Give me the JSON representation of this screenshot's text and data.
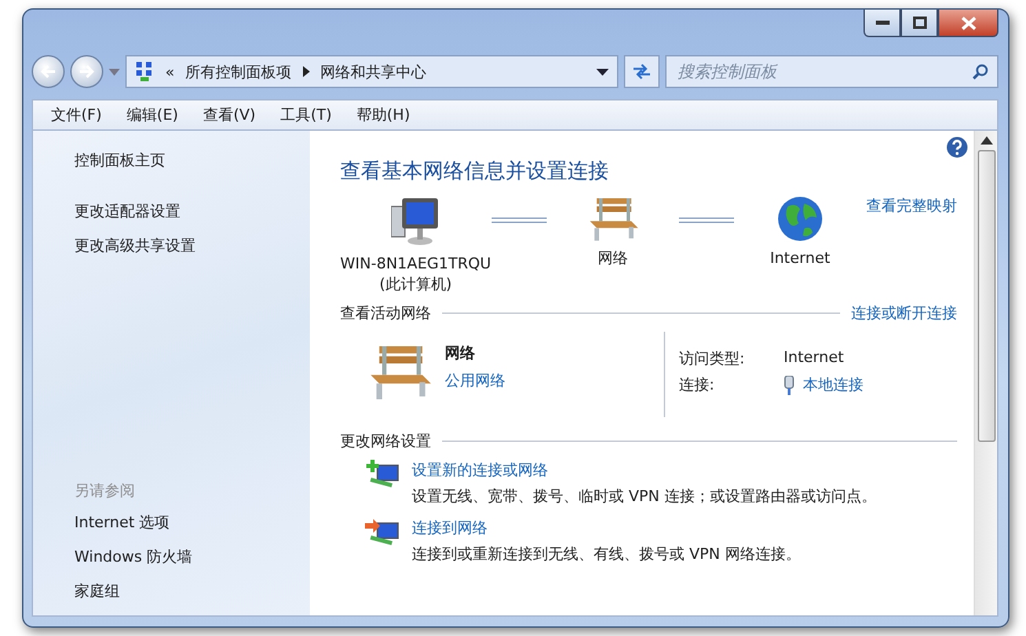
{
  "address_bar": {
    "overflow": "«",
    "breadcrumbs": [
      "所有控制面板项",
      "网络和共享中心"
    ]
  },
  "search": {
    "placeholder": "搜索控制面板"
  },
  "menu": [
    "文件(F)",
    "编辑(E)",
    "查看(V)",
    "工具(T)",
    "帮助(H)"
  ],
  "sidebar": {
    "links": [
      "控制面板主页",
      "更改适配器设置",
      "更改高级共享设置"
    ],
    "see_also_title": "另请参阅",
    "see_also": [
      "Internet 选项",
      "Windows 防火墙",
      "家庭组"
    ]
  },
  "main": {
    "title": "查看基本网络信息并设置连接",
    "full_map_link": "查看完整映射",
    "map_nodes": [
      {
        "kind": "computer",
        "label": "WIN-8N1AEG1TRQU",
        "sublabel": "(此计算机)"
      },
      {
        "kind": "bench",
        "label": "网络"
      },
      {
        "kind": "globe",
        "label": "Internet"
      }
    ],
    "active_networks": {
      "title": "查看活动网络",
      "link": "连接或断开连接",
      "network_name": "网络",
      "network_type": "公用网络",
      "details": [
        {
          "kind": "text",
          "label": "访问类型:",
          "value": "Internet"
        },
        {
          "kind": "link",
          "label": "连接:",
          "value": "本地连接"
        }
      ]
    },
    "change_settings": {
      "title": "更改网络设置",
      "tasks": [
        {
          "kind": "new",
          "link": "设置新的连接或网络",
          "description": "设置无线、宽带、拨号、临时或 VPN 连接；或设置路由器或访问点。"
        },
        {
          "kind": "connect",
          "link": "连接到网络",
          "description": "连接到或重新连接到无线、有线、拨号或 VPN 网络连接。"
        }
      ]
    }
  }
}
